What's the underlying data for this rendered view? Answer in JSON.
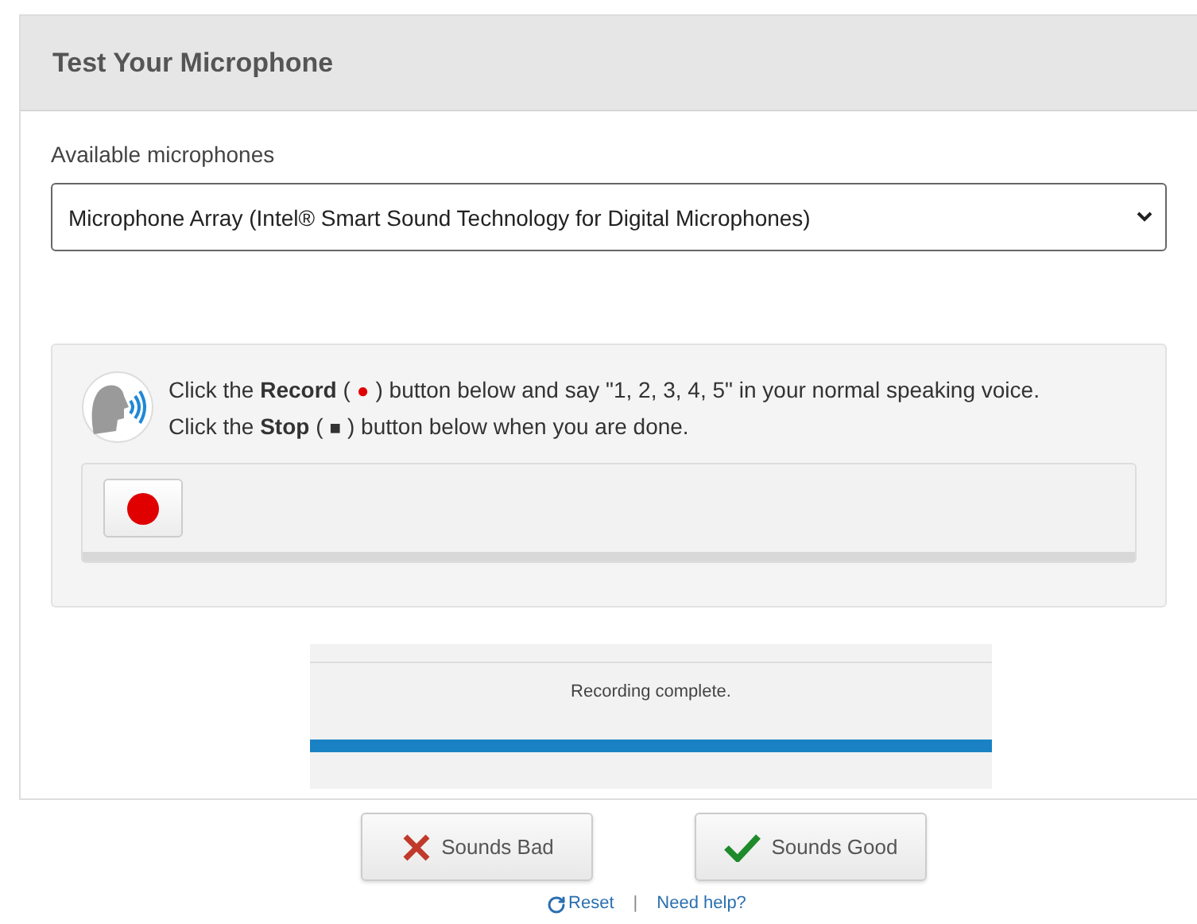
{
  "title": "Test Your Microphone",
  "microphones": {
    "label": "Available microphones",
    "value": "Microphone Array (Intel® Smart Sound Technology for Digital Microphones)"
  },
  "instructions": [
    {
      "kind": "record",
      "before": "Click the **Record** (",
      "symbol": "●",
      "after": ") button below and say \"1, 2, 3, 4, 5\" in your normal speaking voice."
    },
    {
      "kind": "stop",
      "before": "Click the **Stop** (",
      "symbol": "■",
      "after": ") button below when you are done."
    }
  ],
  "status": {
    "text": "Recording complete.",
    "level": 1
  },
  "buttons": [
    {
      "kind": "bad",
      "label": "Sounds Bad"
    },
    {
      "kind": "good",
      "label": "Sounds Good"
    }
  ],
  "links": [
    {
      "kind": "reset",
      "label": "Reset"
    },
    {
      "kind": "separator",
      "label": "|"
    },
    {
      "kind": "help",
      "label": "Need help?"
    }
  ]
}
